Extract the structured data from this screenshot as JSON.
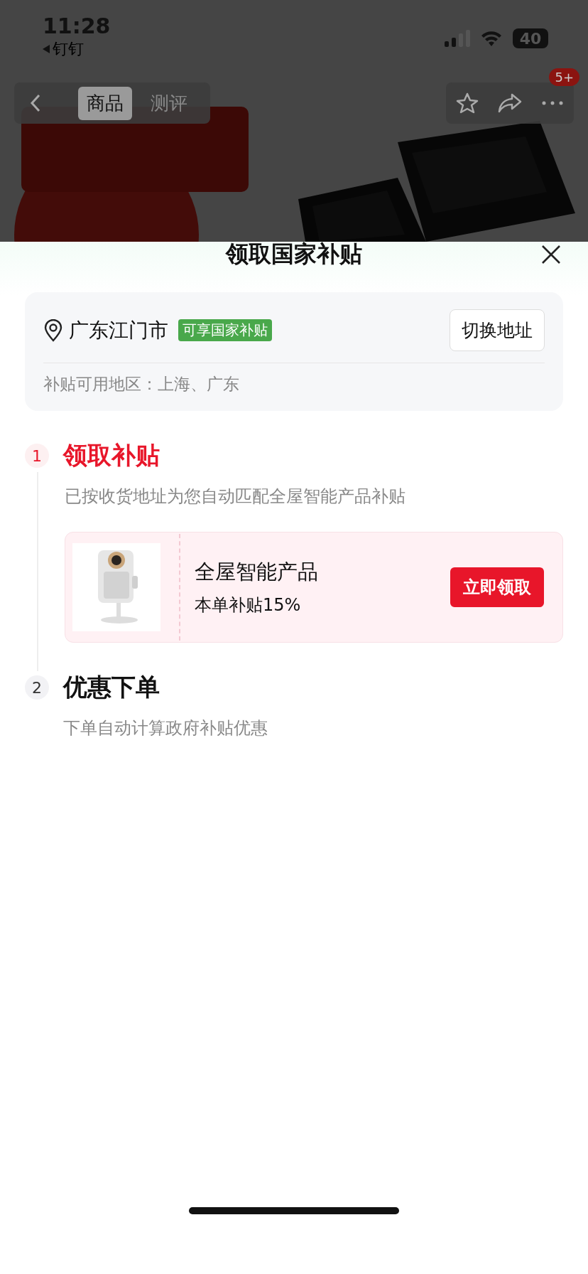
{
  "status_bar": {
    "time": "11:28",
    "back_app": "钉钉",
    "battery": "40"
  },
  "nav": {
    "tabs": [
      {
        "label": "商品",
        "selected": true
      },
      {
        "label": "测评",
        "selected": false
      }
    ],
    "badge": "5+"
  },
  "sheet": {
    "title": "领取国家补贴",
    "address": {
      "city": "广东江门市",
      "tag": "可享国家补贴",
      "button": "切换地址",
      "regions": "补贴可用地区：上海、广东"
    },
    "steps": [
      {
        "number": "1",
        "title": "领取补贴",
        "active": true,
        "description": "已按收货地址为您自动匹配全屋智能产品补贴",
        "coupon": {
          "kind": "picture",
          "name": "全屋智能产品",
          "rate": "本单补贴15%",
          "button": "立即领取"
        }
      },
      {
        "number": "2",
        "title": "优惠下单",
        "active": false,
        "description": "下单自动计算政府补贴优惠"
      }
    ]
  }
}
